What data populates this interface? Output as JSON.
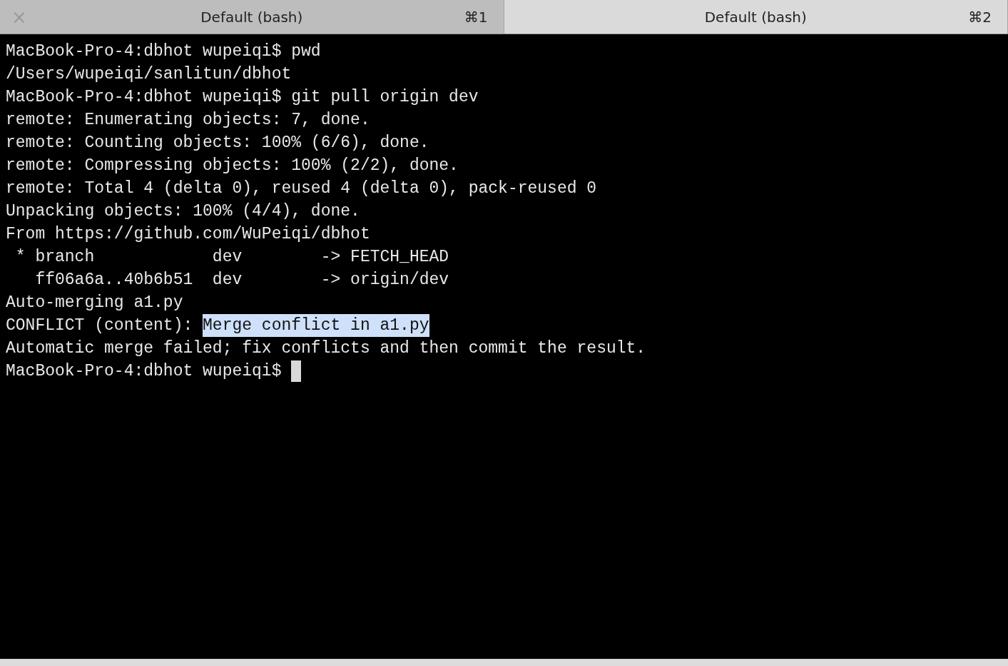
{
  "tabs": [
    {
      "title": "Default (bash)",
      "shortcut": "⌘1",
      "selected": false,
      "close": "×"
    },
    {
      "title": "Default (bash)",
      "shortcut": "⌘2",
      "selected": true
    }
  ],
  "terminal": {
    "lines": [
      {
        "text": "MacBook-Pro-4:dbhot wupeiqi$ pwd"
      },
      {
        "text": "/Users/wupeiqi/sanlitun/dbhot"
      },
      {
        "text": "MacBook-Pro-4:dbhot wupeiqi$ git pull origin dev"
      },
      {
        "text": "remote: Enumerating objects: 7, done."
      },
      {
        "text": "remote: Counting objects: 100% (6/6), done."
      },
      {
        "text": "remote: Compressing objects: 100% (2/2), done."
      },
      {
        "text": "remote: Total 4 (delta 0), reused 4 (delta 0), pack-reused 0"
      },
      {
        "text": "Unpacking objects: 100% (4/4), done."
      },
      {
        "text": "From https://github.com/WuPeiqi/dbhot"
      },
      {
        "text": " * branch            dev        -> FETCH_HEAD"
      },
      {
        "text": "   ff06a6a..40b6b51  dev        -> origin/dev"
      },
      {
        "text": "Auto-merging a1.py"
      },
      {
        "text": "CONFLICT (content): ",
        "highlighted": "Merge conflict in a1.py"
      },
      {
        "text": "Automatic merge failed; fix conflicts and then commit the result."
      },
      {
        "text": "MacBook-Pro-4:dbhot wupeiqi$ ",
        "cursor": true
      }
    ]
  }
}
